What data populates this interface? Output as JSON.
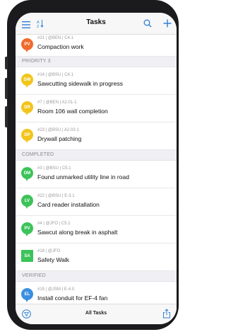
{
  "header": {
    "title": "Tasks",
    "icons": [
      "menu-icon",
      "sort-icon",
      "search-icon",
      "add-icon"
    ]
  },
  "sections": [
    {
      "label": "",
      "items": [
        {
          "badge": "PV",
          "badge_shape": "pin",
          "badge_color": "#ef6c2e",
          "meta": "#21 | @BEN | C4.1",
          "title": "Compaction work"
        }
      ]
    },
    {
      "label": "PRIORITY 3",
      "items": [
        {
          "badge": "DW",
          "badge_shape": "pin",
          "badge_color": "#f2c51d",
          "meta": "#14 | @BSU | C4.1",
          "title": "Sawcutting sidewalk in progress"
        },
        {
          "badge": "DR",
          "badge_shape": "pin",
          "badge_color": "#f2c51d",
          "meta": "#7 | @BEN | A2.01-1",
          "title": "Room 106 wall completion"
        },
        {
          "badge": "DP",
          "badge_shape": "pin",
          "badge_color": "#f2c51d",
          "meta": "#23 | @BSU | A2.03-1",
          "title": "Drywall patching"
        }
      ]
    },
    {
      "label": "COMPLETED",
      "items": [
        {
          "badge": "DM",
          "badge_shape": "pin",
          "badge_color": "#3cc35a",
          "meta": "#3 | @BSU | C5.1",
          "title": "Found unmarked utility line in road"
        },
        {
          "badge": "LV",
          "badge_shape": "pin",
          "badge_color": "#3cc35a",
          "meta": "#22 | @BSU | E-3.1",
          "title": "Card reader installation"
        },
        {
          "badge": "PV",
          "badge_shape": "pin",
          "badge_color": "#3cc35a",
          "meta": "#4 | @JFO | C5.1",
          "title": "Sawcut along break in asphalt"
        },
        {
          "badge": "SA",
          "badge_shape": "square",
          "badge_color": "#3cc35a",
          "meta": "#18 | @JFO",
          "title": "Safety Walk"
        }
      ]
    },
    {
      "label": "VERIFIED",
      "items": [
        {
          "badge": "EL",
          "badge_shape": "pin",
          "badge_color": "#3b8fe0",
          "meta": "#15 | @JSM | E-4.0",
          "title": "Install conduit for EF-4 fan"
        }
      ]
    }
  ],
  "footer": {
    "label": "All Tasks",
    "icons": [
      "filter-icon",
      "share-icon"
    ]
  },
  "accent": "#2f7fd8"
}
